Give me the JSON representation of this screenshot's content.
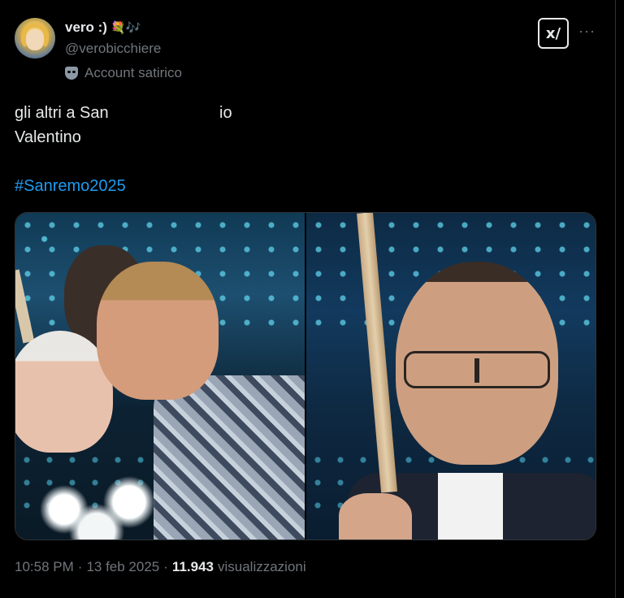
{
  "author": {
    "display_name": "vero :)",
    "name_emojis": "💐🎶",
    "handle": "@verobicchiere",
    "label": "Account satirico",
    "label_icon": "theater-mask-icon"
  },
  "actions": {
    "grok_label": "x/",
    "more_label": "···"
  },
  "tweet": {
    "text_left": "gli altri a San",
    "text_right": "io",
    "text_left_cont": "Valentino",
    "hashtag": "#Sanremo2025"
  },
  "meta": {
    "time": "10:58 PM",
    "date": "13 feb 2025",
    "views_count": "11.943",
    "views_label": "visualizzazioni"
  },
  "colors": {
    "background": "#000000",
    "text": "#e7e9ea",
    "secondary": "#71767b",
    "link": "#1d9bf0"
  }
}
